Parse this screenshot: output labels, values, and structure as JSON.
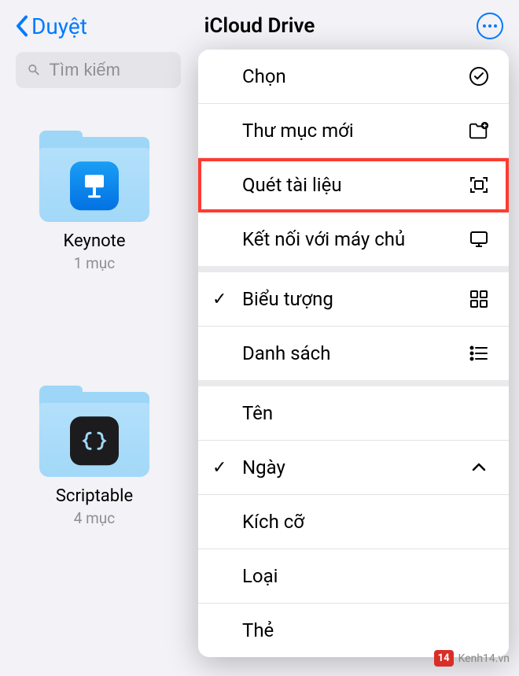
{
  "header": {
    "back_label": "Duyệt",
    "title": "iCloud Drive"
  },
  "search": {
    "placeholder": "Tìm kiếm"
  },
  "folders": [
    {
      "name": "Keynote",
      "count": "1 mục"
    },
    {
      "name": "Scriptable",
      "count": "4 mục"
    }
  ],
  "menu": {
    "group1": [
      {
        "label": "Chọn",
        "icon": "check-circle"
      },
      {
        "label": "Thư mục mới",
        "icon": "folder-plus"
      },
      {
        "label": "Quét tài liệu",
        "icon": "scan",
        "highlight": true
      },
      {
        "label": "Kết nối với máy chủ",
        "icon": "server"
      }
    ],
    "group2": [
      {
        "label": "Biểu tượng",
        "icon": "grid",
        "checked": true
      },
      {
        "label": "Danh sách",
        "icon": "list"
      }
    ],
    "group3": [
      {
        "label": "Tên"
      },
      {
        "label": "Ngày",
        "icon": "chevron-up",
        "checked": true
      },
      {
        "label": "Kích cỡ"
      },
      {
        "label": "Loại"
      },
      {
        "label": "Thẻ"
      }
    ]
  },
  "watermark": {
    "badge": "14",
    "text": "Kenh14.vn"
  }
}
